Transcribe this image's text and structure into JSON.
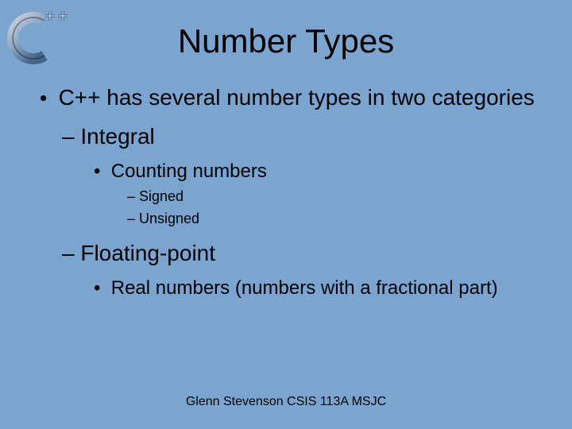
{
  "title": "Number Types",
  "bullets": {
    "b1": "C++ has several number types in two categories",
    "b2a": "Integral",
    "b3a": "Counting numbers",
    "b4a": "Signed",
    "b4b": "Unsigned",
    "b2b": "Floating-point",
    "b3b": "Real numbers (numbers with a fractional part)"
  },
  "footer": "Glenn Stevenson CSIS 113A MSJC",
  "logo": {
    "alt": "C++ logo"
  }
}
